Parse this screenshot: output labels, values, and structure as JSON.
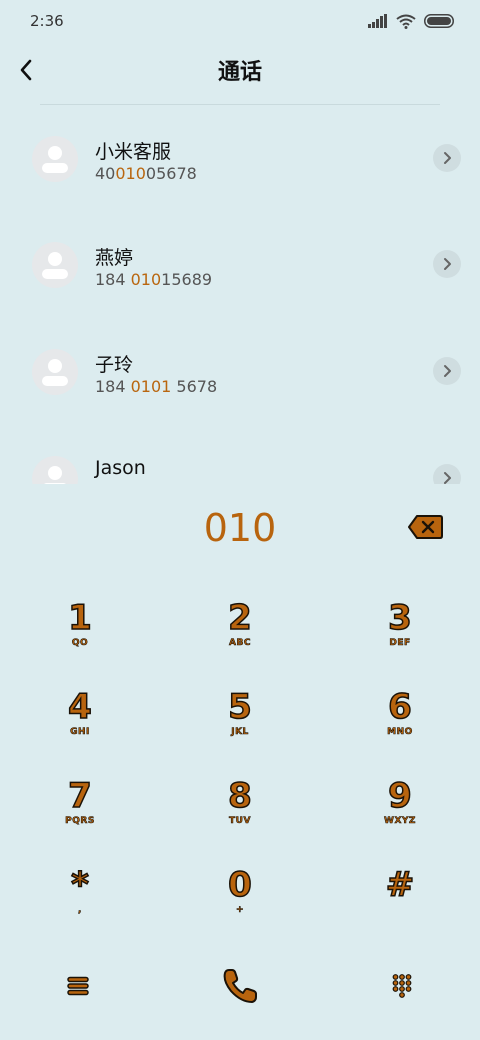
{
  "status_bar": {
    "time": "2:36"
  },
  "header": {
    "title": "通话"
  },
  "contacts": [
    {
      "name": "小米客服",
      "number_parts": [
        "40",
        "010",
        "05678"
      ]
    },
    {
      "name": "燕婷",
      "number_parts": [
        "184 ",
        "010",
        "15689"
      ]
    },
    {
      "name": "子玲",
      "number_parts": [
        "184 ",
        "0101",
        " 5678"
      ]
    },
    {
      "name": "Jason",
      "number_parts": [
        "",
        "",
        ""
      ]
    }
  ],
  "dialer": {
    "entered": "010"
  },
  "keypad": {
    "keys": [
      {
        "digit": "1",
        "letters": "QO"
      },
      {
        "digit": "2",
        "letters": "ABC"
      },
      {
        "digit": "3",
        "letters": "DEF"
      },
      {
        "digit": "4",
        "letters": "GHI"
      },
      {
        "digit": "5",
        "letters": "JKL"
      },
      {
        "digit": "6",
        "letters": "MNO"
      },
      {
        "digit": "7",
        "letters": "PQRS"
      },
      {
        "digit": "8",
        "letters": "TUV"
      },
      {
        "digit": "9",
        "letters": "WXYZ"
      },
      {
        "digit": "*",
        "letters": ","
      },
      {
        "digit": "0",
        "letters": "+"
      },
      {
        "digit": "#",
        "letters": ""
      }
    ]
  },
  "colors": {
    "accent": "#b8640e",
    "background": "#dcecef"
  },
  "icons": {
    "back": "chevron-left-icon",
    "backspace": "backspace-icon",
    "menu": "menu-icon",
    "call": "phone-icon",
    "dialpad": "dialpad-icon"
  }
}
